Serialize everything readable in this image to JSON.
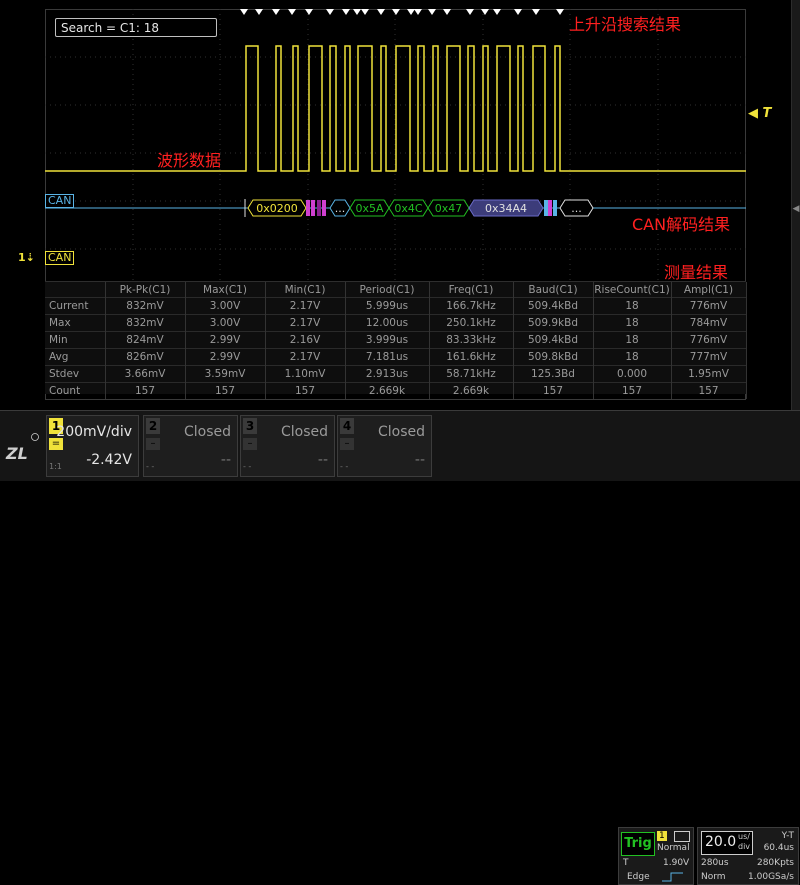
{
  "search": {
    "text": "Search = C1: 18"
  },
  "annotations": {
    "rising_edge": "上升沿搜索结果",
    "waveform": "波形数据",
    "can_decode": "CAN解码结果",
    "measurement": "测量结果"
  },
  "markers": {
    "trigger": "◀ T",
    "ch1": "1",
    "ch1_arrow": "⇣"
  },
  "bus_labels": {
    "can_top": "CAN",
    "can_bottom": "CAN"
  },
  "can_frames": [
    "0x0200",
    "...",
    "0x5A",
    "0x4C",
    "0x47",
    "0x34A4",
    "..."
  ],
  "measurements": {
    "headers": [
      "",
      "Pk-Pk(C1)",
      "Max(C1)",
      "Min(C1)",
      "Period(C1)",
      "Freq(C1)",
      "Baud(C1)",
      "RiseCount(C1)",
      "Ampl(C1)"
    ],
    "rows": [
      [
        "Current",
        "832mV",
        "3.00V",
        "2.17V",
        "5.999us",
        "166.7kHz",
        "509.4kBd",
        "18",
        "776mV"
      ],
      [
        "Max",
        "832mV",
        "3.00V",
        "2.17V",
        "12.00us",
        "250.1kHz",
        "509.9kBd",
        "18",
        "784mV"
      ],
      [
        "Min",
        "824mV",
        "2.99V",
        "2.16V",
        "3.999us",
        "83.33kHz",
        "509.4kBd",
        "18",
        "776mV"
      ],
      [
        "Avg",
        "826mV",
        "2.99V",
        "2.17V",
        "7.181us",
        "161.6kHz",
        "509.8kBd",
        "18",
        "777mV"
      ],
      [
        "Stdev",
        "3.66mV",
        "3.59mV",
        "1.10mV",
        "2.913us",
        "58.71kHz",
        "125.3Bd",
        "0.000",
        "1.95mV"
      ],
      [
        "Count",
        "157",
        "157",
        "157",
        "2.669k",
        "2.669k",
        "157",
        "157",
        "157"
      ]
    ]
  },
  "channels": [
    {
      "num": "1",
      "scale": "200mV/div",
      "offset": "-2.42V",
      "bw": "1:1",
      "active": true
    },
    {
      "num": "2",
      "scale": "Closed",
      "offset": "--",
      "bw": "- -",
      "active": false
    },
    {
      "num": "3",
      "scale": "Closed",
      "offset": "--",
      "bw": "- -",
      "active": false
    },
    {
      "num": "4",
      "scale": "Closed",
      "offset": "--",
      "bw": "- -",
      "active": false
    }
  ],
  "trigger": {
    "button": "Trig",
    "source": "1",
    "mode": "Normal",
    "type_label": "T",
    "level": "1.90V",
    "edge_label": "Edge"
  },
  "timebase": {
    "scale": "20.0",
    "unit_top": "us/",
    "unit_bottom": "div",
    "mode": "Y-T",
    "delay": "60.4us",
    "memory": "280us",
    "points": "280Kpts",
    "acq": "Norm",
    "rate": "1.00GSa/s"
  },
  "colors": {
    "ch1": "#f0e23a",
    "bus": "#5ab4e6",
    "annot": "#ff2020",
    "trig": "#22c022"
  }
}
